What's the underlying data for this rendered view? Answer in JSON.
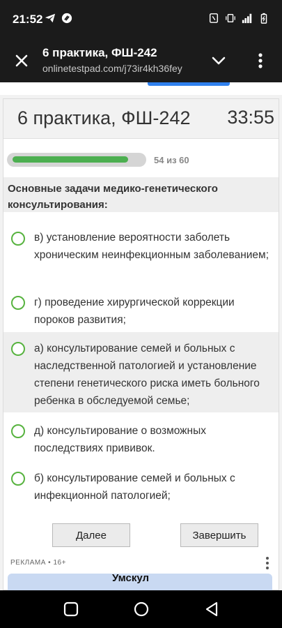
{
  "status_bar": {
    "time": "21:52",
    "left_icons": [
      "telegram-icon",
      "shazam-icon"
    ],
    "right_icons": [
      "nfc-icon",
      "vibrate-icon",
      "signal-icon",
      "battery-icon"
    ]
  },
  "browser_bar": {
    "title": "6 практика, ФШ-242",
    "url": "onlinetestpad.com/j73ir4kh36fey"
  },
  "test": {
    "title": "6 практика, ФШ-242",
    "timer": "33:55",
    "progress_text": "54 из 60",
    "progress_fraction": 0.9,
    "question": "Основные задачи медико-генетического консультирования:",
    "options": [
      {
        "text": "в) установление вероятности заболеть хроническим неинфекционным заболеванием;",
        "highlighted": false
      },
      {
        "text": "г) проведение хирургической коррекции пороков развития;",
        "highlighted": false
      },
      {
        "text": "а) консультирование семей и больных с наследственной патологией и установление степени генетического риска иметь больного ребенка в обследуемой семье;",
        "highlighted": true
      },
      {
        "text": "д) консультирование о возможных последствиях прививок.",
        "highlighted": false
      },
      {
        "text": "б) консультирование семей и больных с инфекционной патологией;",
        "highlighted": false
      }
    ],
    "next_label": "Далее",
    "finish_label": "Завершить"
  },
  "ad": {
    "label": "РЕКЛАМА • 16+",
    "logo_text": "Умскул"
  },
  "colors": {
    "accent_green": "#57b33f",
    "progress_green": "#4caf50",
    "link_blue": "#2f80ed"
  }
}
